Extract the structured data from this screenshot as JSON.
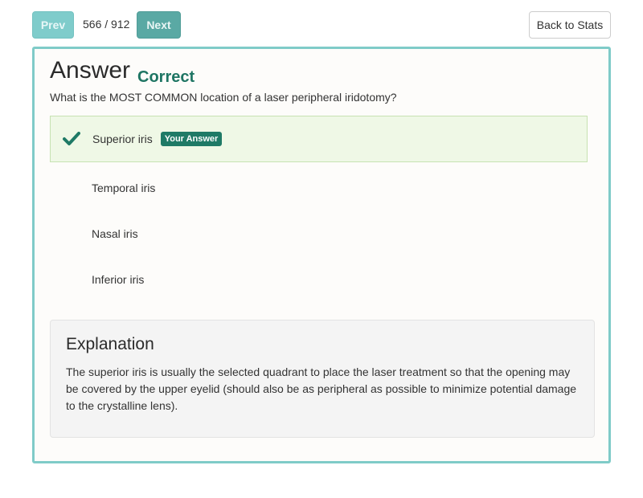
{
  "nav": {
    "prev_label": "Prev",
    "counter": "566 / 912",
    "next_label": "Next",
    "back_label": "Back to Stats"
  },
  "answer": {
    "title": "Answer",
    "status": "Correct",
    "question": "What is the MOST COMMON location of a laser peripheral iridotomy?",
    "options": [
      {
        "label": "Superior iris",
        "selected": true,
        "correct": true,
        "badge": "Your Answer",
        "icon": "checkmark-icon"
      },
      {
        "label": "Temporal iris",
        "selected": false,
        "correct": false
      },
      {
        "label": "Nasal iris",
        "selected": false,
        "correct": false
      },
      {
        "label": "Inferior iris",
        "selected": false,
        "correct": false
      }
    ]
  },
  "explanation": {
    "title": "Explanation",
    "text": "The superior iris is usually the selected quadrant to place the laser treatment so that the opening may be covered by the upper eyelid (should also be as peripheral as possible to minimize potential damage to the crystalline lens)."
  },
  "colors": {
    "accent": "#1f7a66",
    "card_border": "#7fcbc8",
    "selected_bg": "#eff8e6"
  }
}
